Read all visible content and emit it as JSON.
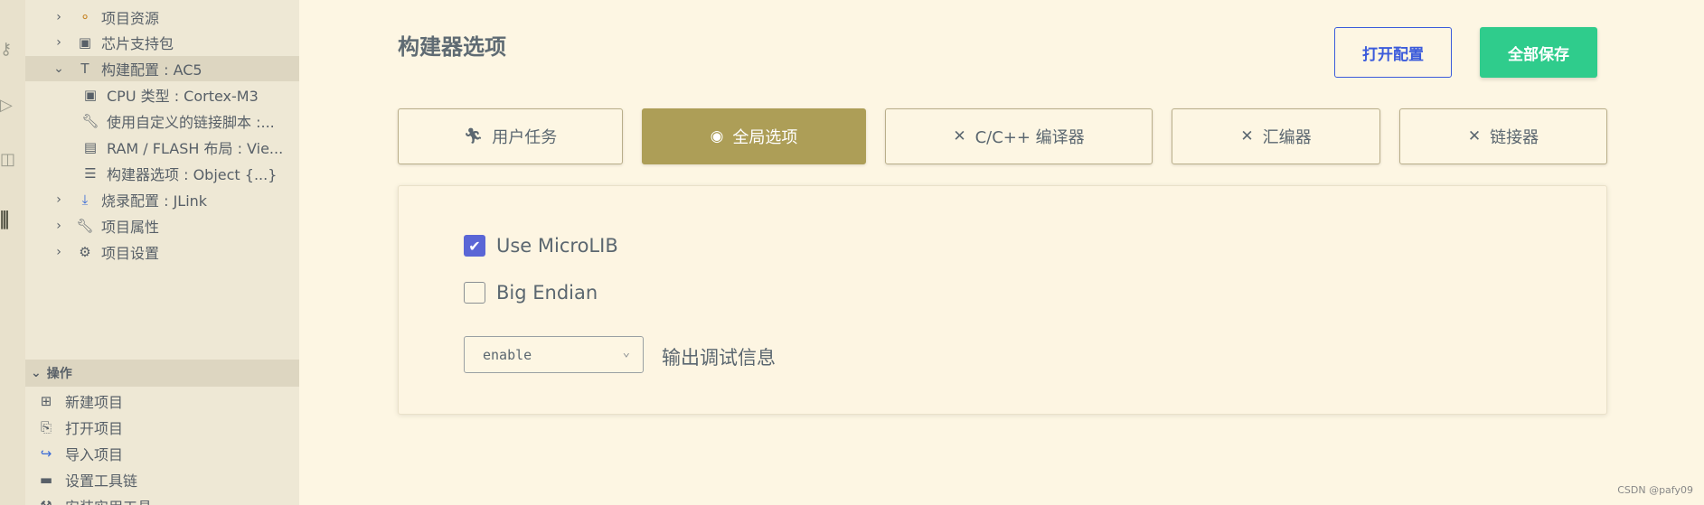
{
  "activity_bar": {
    "icons": [
      "key-icon",
      "play-icon",
      "extensions-icon",
      "chip-icon"
    ]
  },
  "sidebar": {
    "tree": [
      {
        "label": "项目资源",
        "icon": "resource-icon",
        "expanded": false
      },
      {
        "label": "芯片支持包",
        "icon": "chip-icon",
        "expanded": false
      },
      {
        "label": "构建配置 : AC5",
        "icon": "hammer-icon",
        "expanded": true,
        "selected": true
      },
      {
        "label": "CPU 类型 : Cortex-M3",
        "icon": "chip-icon",
        "child": true
      },
      {
        "label": "使用自定义的链接脚本 :...",
        "icon": "wrench-icon",
        "child": true
      },
      {
        "label": "RAM / FLASH 布局 : Vie...",
        "icon": "memory-icon",
        "child": true
      },
      {
        "label": "构建器选项 : Object {...}",
        "icon": "options-icon",
        "child": true
      },
      {
        "label": "烧录配置 : JLink",
        "icon": "download-icon",
        "expanded": false
      },
      {
        "label": "项目属性",
        "icon": "wrench-icon",
        "expanded": false
      },
      {
        "label": "项目设置",
        "icon": "gear-icon",
        "expanded": false
      }
    ],
    "operations_title": "操作",
    "operations": [
      {
        "label": "新建项目",
        "icon": "new-project-icon"
      },
      {
        "label": "打开项目",
        "icon": "open-project-icon"
      },
      {
        "label": "导入项目",
        "icon": "import-icon"
      },
      {
        "label": "设置工具链",
        "icon": "toolbox-icon"
      },
      {
        "label": "安装实用工具",
        "icon": "install-icon"
      }
    ]
  },
  "main": {
    "title": "构建器选项",
    "open_config_label": "打开配置",
    "save_all_label": "全部保存",
    "tabs": [
      {
        "label": "用户任务",
        "icon": "run-icon"
      },
      {
        "label": "全局选项",
        "icon": "globe-icon",
        "active": true
      },
      {
        "label": "C/C++ 编译器",
        "icon": "tools-icon"
      },
      {
        "label": "汇编器",
        "icon": "tools-icon"
      },
      {
        "label": "链接器",
        "icon": "tools-icon"
      }
    ],
    "options": {
      "use_microlib_label": "Use MicroLIB",
      "use_microlib_checked": true,
      "big_endian_label": "Big Endian",
      "big_endian_checked": false,
      "debug_info_value": "enable",
      "debug_info_label": "输出调试信息"
    }
  },
  "footer": {
    "text": "CSDN @pafy09"
  },
  "colors": {
    "background": "#fdf6e3",
    "sidebar": "#eee8d5",
    "active_tab": "#ad9e57",
    "save_button": "#2fcc8c",
    "open_button_border": "#3b5bdb",
    "checkbox_checked": "#5a66d6"
  }
}
